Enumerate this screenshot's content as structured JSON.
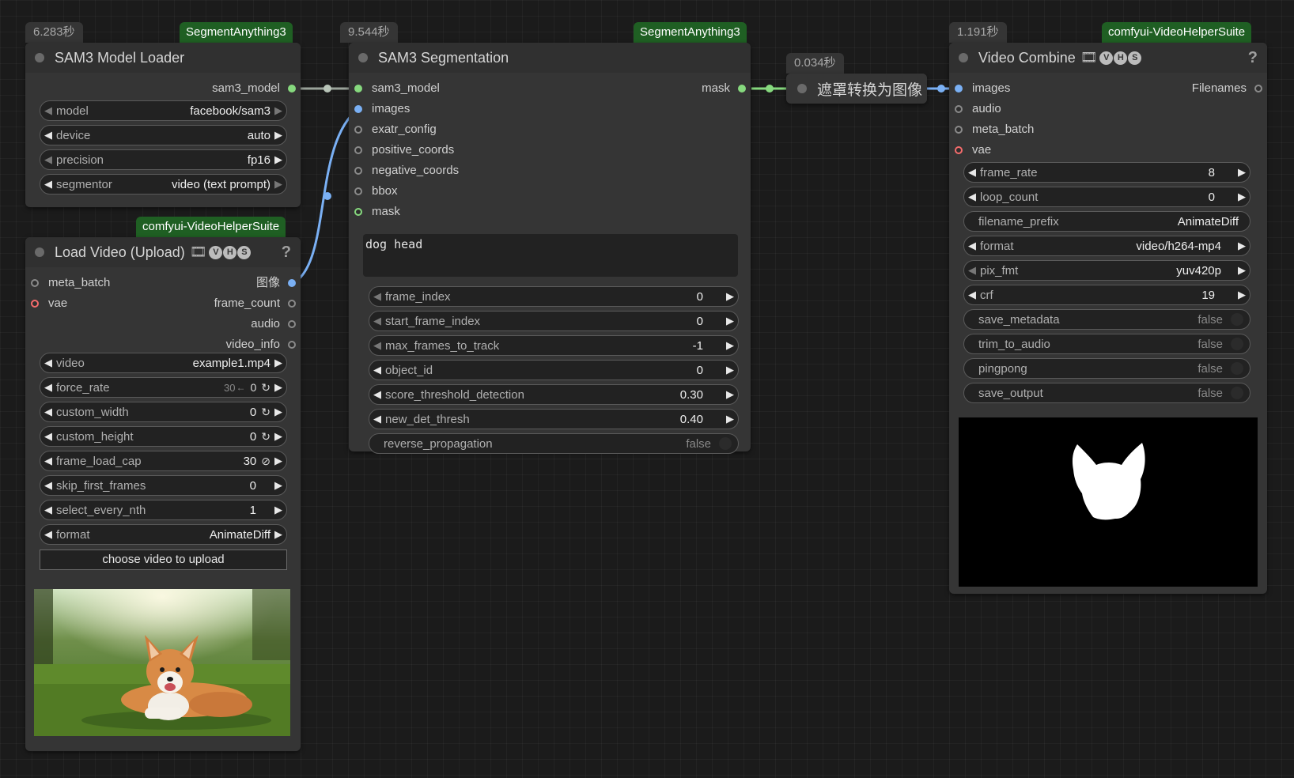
{
  "nodes": {
    "sam3_loader": {
      "time": "6.283秒",
      "source": "SegmentAnything3",
      "title": "SAM3 Model Loader",
      "outputs": {
        "sam3_model": "sam3_model"
      },
      "widgets": [
        {
          "label": "model",
          "value": "facebook/sam3"
        },
        {
          "label": "device",
          "value": "auto"
        },
        {
          "label": "precision",
          "value": "fp16"
        },
        {
          "label": "segmentor",
          "value": "video (text prompt)"
        }
      ]
    },
    "load_video": {
      "source": "comfyui-VideoHelperSuite",
      "title": "Load Video (Upload)",
      "help": "?",
      "inputs": {
        "meta_batch": "meta_batch",
        "vae": "vae"
      },
      "outputs": {
        "image": "图像",
        "frame_count": "frame_count",
        "audio": "audio",
        "video_info": "video_info"
      },
      "widgets": [
        {
          "label": "video",
          "value": "example1.mp4"
        },
        {
          "label": "force_rate",
          "value": "30",
          "extra": "0"
        },
        {
          "label": "custom_width",
          "value": "0"
        },
        {
          "label": "custom_height",
          "value": "0"
        },
        {
          "label": "frame_load_cap",
          "value": "30"
        },
        {
          "label": "skip_first_frames",
          "value": "0"
        },
        {
          "label": "select_every_nth",
          "value": "1"
        },
        {
          "label": "format",
          "value": "AnimateDiff"
        }
      ],
      "upload_button": "choose video to upload",
      "preview_icon": "corgi-photo"
    },
    "sam3_seg": {
      "time": "9.544秒",
      "source": "SegmentAnything3",
      "title": "SAM3 Segmentation",
      "inputs": {
        "sam3_model": "sam3_model",
        "images": "images",
        "exatr_config": "exatr_config",
        "positive_coords": "positive_coords",
        "negative_coords": "negative_coords",
        "bbox": "bbox",
        "mask": "mask"
      },
      "outputs": {
        "mask": "mask"
      },
      "prompt": "dog head",
      "widgets": [
        {
          "label": "frame_index",
          "value": "0"
        },
        {
          "label": "start_frame_index",
          "value": "0"
        },
        {
          "label": "max_frames_to_track",
          "value": "-1"
        },
        {
          "label": "object_id",
          "value": "0"
        },
        {
          "label": "score_threshold_detection",
          "value": "0.30"
        },
        {
          "label": "new_det_thresh",
          "value": "0.40"
        }
      ],
      "toggle": {
        "label": "reverse_propagation",
        "value": "false"
      }
    },
    "mask_to_image": {
      "time": "0.034秒",
      "title": "遮罩转换为图像"
    },
    "video_combine": {
      "time": "1.191秒",
      "source": "comfyui-VideoHelperSuite",
      "title": "Video Combine",
      "help": "?",
      "inputs": {
        "images": "images",
        "audio": "audio",
        "meta_batch": "meta_batch",
        "vae": "vae"
      },
      "outputs": {
        "filenames": "Filenames"
      },
      "widgets": [
        {
          "label": "frame_rate",
          "value": "8"
        },
        {
          "label": "loop_count",
          "value": "0"
        },
        {
          "label": "filename_prefix",
          "value": "AnimateDiff"
        },
        {
          "label": "format",
          "value": "video/h264-mp4"
        },
        {
          "label": "pix_fmt",
          "value": "yuv420p"
        },
        {
          "label": "crf",
          "value": "19"
        }
      ],
      "toggles": [
        {
          "label": "save_metadata",
          "value": "false"
        },
        {
          "label": "trim_to_audio",
          "value": "false"
        },
        {
          "label": "pingpong",
          "value": "false"
        },
        {
          "label": "save_output",
          "value": "false"
        }
      ],
      "preview_icon": "dog-head-mask"
    }
  },
  "colors": {
    "canvas": "#1b1b1b",
    "node": "#353535",
    "source_tag": "#1f5f23",
    "link_model": "#86d97e",
    "link_image": "#7ab0f4",
    "slot_vae": "#f56c6c"
  }
}
